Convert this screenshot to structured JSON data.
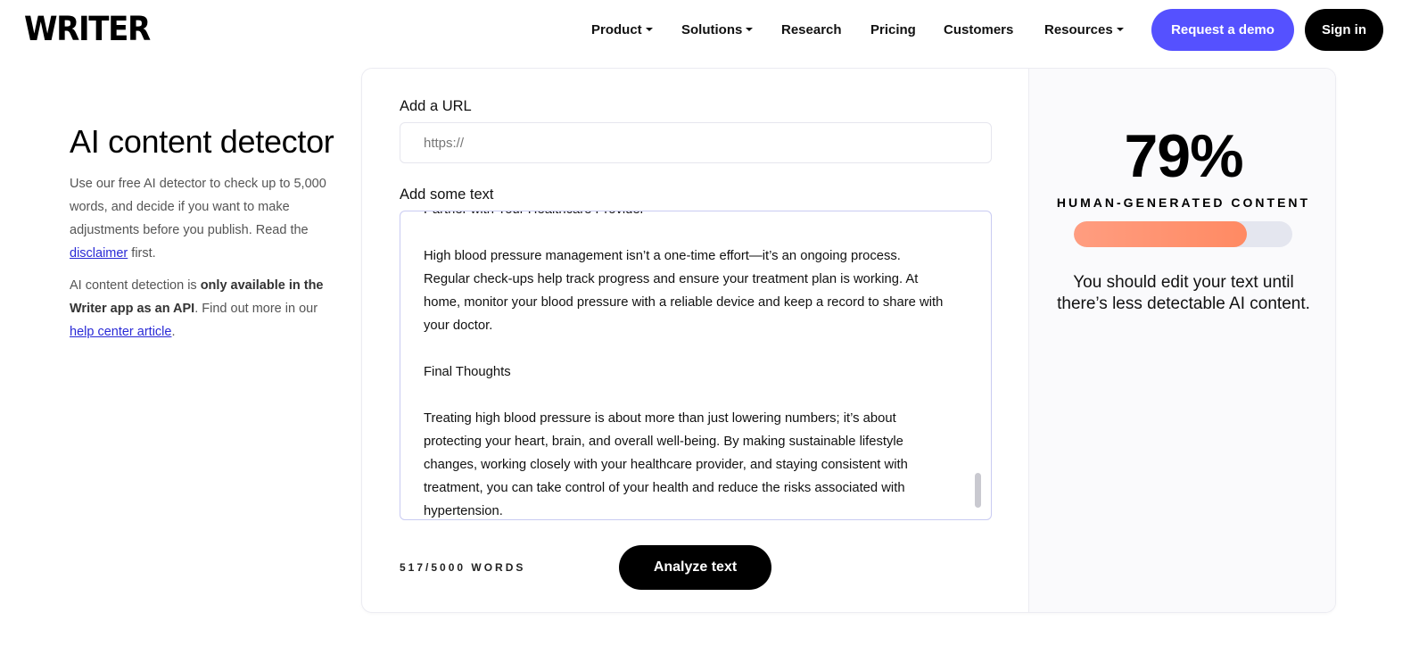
{
  "header": {
    "logo": "WRITER",
    "nav": [
      {
        "label": "Product",
        "dropdown": true
      },
      {
        "label": "Solutions",
        "dropdown": true
      },
      {
        "label": "Research",
        "dropdown": false
      },
      {
        "label": "Pricing",
        "dropdown": false
      },
      {
        "label": "Customers",
        "dropdown": false
      },
      {
        "label": "Resources",
        "dropdown": true
      }
    ],
    "demo_label": "Request a demo",
    "signin_label": "Sign in"
  },
  "intro": {
    "title": "AI content detector",
    "p1_text": "Use our free AI detector to check up to 5,000 words, and decide if you want to make adjustments before you publish. Read the ",
    "p1_link": "disclaimer",
    "p1_after": " first.",
    "p2_text": "AI content detection is ",
    "p2_bold": "only available in the Writer app as an API",
    "p2_mid": ". Find out more in our ",
    "p2_link": "help center article",
    "p2_after": "."
  },
  "form": {
    "url_label": "Add a URL",
    "url_placeholder": "https://",
    "text_label": "Add some text",
    "text_paragraphs": [
      "Partner with Your Healthcare Provider",
      "High blood pressure management isn’t a one-time effort—it’s an ongoing process. Regular check-ups help track progress and ensure your treatment plan is working. At home, monitor your blood pressure with a reliable device and keep a record to share with your doctor.",
      "Final Thoughts",
      "Treating high blood pressure is about more than just lowering numbers; it’s about protecting your heart, brain, and overall well-being. By making sustainable lifestyle changes, working closely with your healthcare provider, and staying consistent with treatment, you can take control of your health and reduce the risks associated with hypertension."
    ],
    "word_count": "517/5000 WORDS",
    "analyze_label": "Analyze text"
  },
  "result": {
    "score": "79%",
    "score_label": "HUMAN-GENERATED CONTENT",
    "human_fraction": 0.79,
    "advice": "You should edit your text until there’s less detectable AI content."
  },
  "colors": {
    "accent": "#5551ff",
    "bar_fill": "#ff8f6b",
    "bar_track": "#e4e6ef"
  }
}
